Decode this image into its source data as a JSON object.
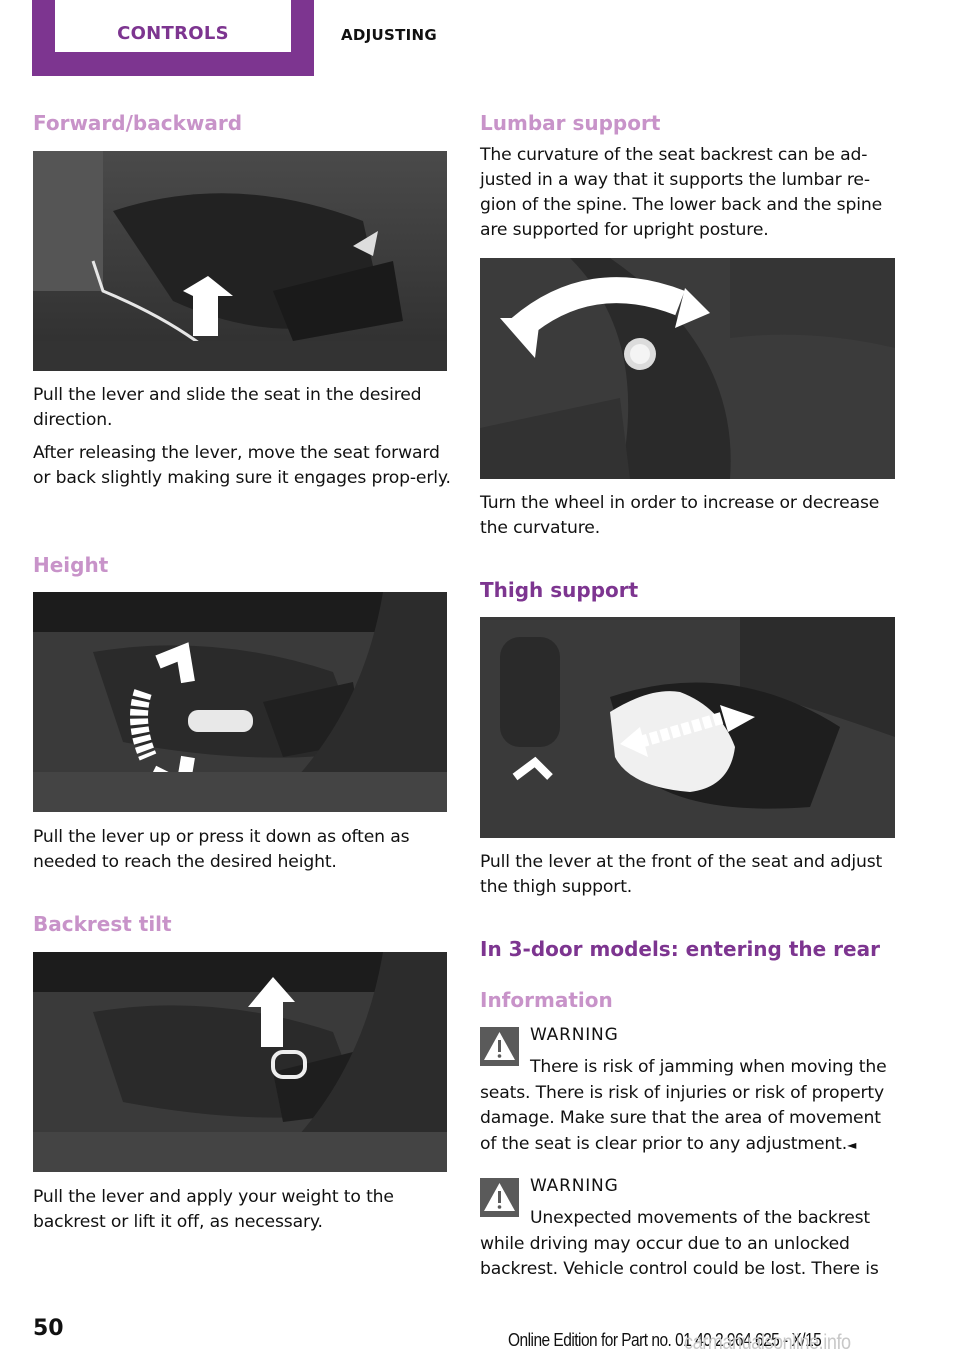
{
  "header": {
    "section_tab": "CONTROLS",
    "subsection": "ADJUSTING",
    "accent_color": "#7d3590"
  },
  "left_column": {
    "forward_backward": {
      "heading": "Forward/backward",
      "figure_alt": "Seat with lever under front edge highlighted and upward arrow",
      "paragraphs": [
        "Pull the lever and slide the seat in the desired direction.",
        "After releasing the lever, move the seat forward or back slightly making sure it engages prop-erly."
      ]
    },
    "height": {
      "heading": "Height",
      "figure_alt": "Seat side lever highlighted with curved up/down arrow",
      "paragraphs": [
        "Pull the lever up or press it down as often as needed to reach the desired height."
      ]
    },
    "backrest_tilt": {
      "heading": "Backrest tilt",
      "figure_alt": "Seat backrest lever highlighted with upward arrow",
      "paragraphs": [
        "Pull the lever and apply your weight to the backrest or lift it off, as necessary."
      ]
    }
  },
  "right_column": {
    "lumbar_support": {
      "heading": "Lumbar support",
      "intro": "The curvature of the seat backrest can be ad-justed in a way that it supports the lumbar re-gion of the spine. The lower back and the spine are supported for upright posture.",
      "figure_alt": "Backrest wheel with bidirectional curved arrow",
      "paragraphs": [
        "Turn the wheel in order to increase or decrease the curvature."
      ]
    },
    "thigh_support": {
      "heading": "Thigh support",
      "figure_alt": "Seat cushion front extension highlighted with horizontal arrow",
      "paragraphs": [
        "Pull the lever at the front of the seat and adjust the thigh support."
      ]
    },
    "entering_rear": {
      "heading": "In 3-door models: entering the rear",
      "subheading": "Information",
      "warnings": [
        {
          "icon": "warning-triangle-icon",
          "title": "WARNING",
          "text": "There is risk of jamming when moving the seats. There is risk of injuries or risk of property damage. Make sure that the area of movement of the seat is clear prior to any adjustment.",
          "end_mark": "◄"
        },
        {
          "icon": "warning-triangle-icon",
          "title": "WARNING",
          "text": "Unexpected movements of the backrest while driving may occur due to an unlocked backrest. Vehicle control could be lost. There is",
          "end_mark": ""
        }
      ]
    }
  },
  "footer": {
    "page_number": "50",
    "edition": "Online Edition for Part no. 01 40 2 964 625 - X/15",
    "watermark": "carmanualsonline.info"
  }
}
